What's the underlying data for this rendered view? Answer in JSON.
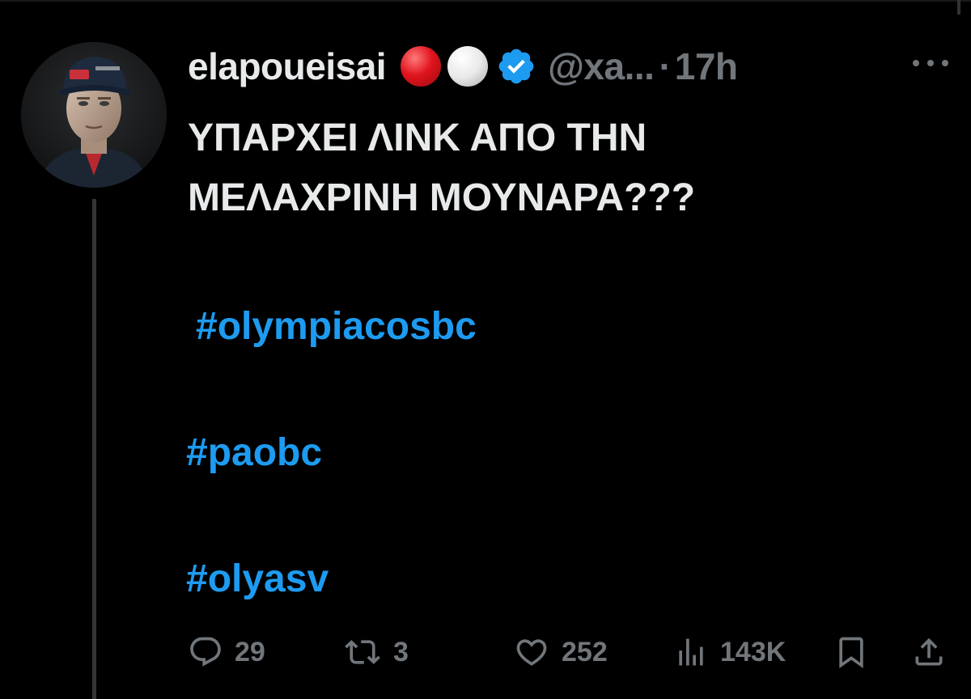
{
  "tweet": {
    "display_name": "elapoueisai",
    "handle": "@xa...",
    "separator": "·",
    "time": "17h",
    "text_lines": [
      "ΥΠΑΡΧΕΙ ΛΙΝΚ ΑΠΟ ΤΗΝ",
      "ΜΕΛΑΧΡΙΝΗ ΜΟΥΝΑΡΑ???"
    ],
    "hashtags": [
      "#olympiacosbc",
      "#paobc",
      "#olyasv"
    ]
  },
  "actions": {
    "replies": "29",
    "reposts": "3",
    "likes": "252",
    "views": "143K"
  },
  "colors": {
    "background": "#000000",
    "text": "#e7e9ea",
    "muted": "#71767b",
    "link": "#1d9bf0",
    "verified": "#1d9bf0"
  },
  "icons": {
    "header": [
      "red-circle-emoji",
      "white-circle-emoji",
      "verified-badge-icon",
      "more-icon"
    ],
    "actions": [
      "reply-icon",
      "repost-icon",
      "like-icon",
      "views-icon",
      "bookmark-icon",
      "share-icon"
    ]
  }
}
